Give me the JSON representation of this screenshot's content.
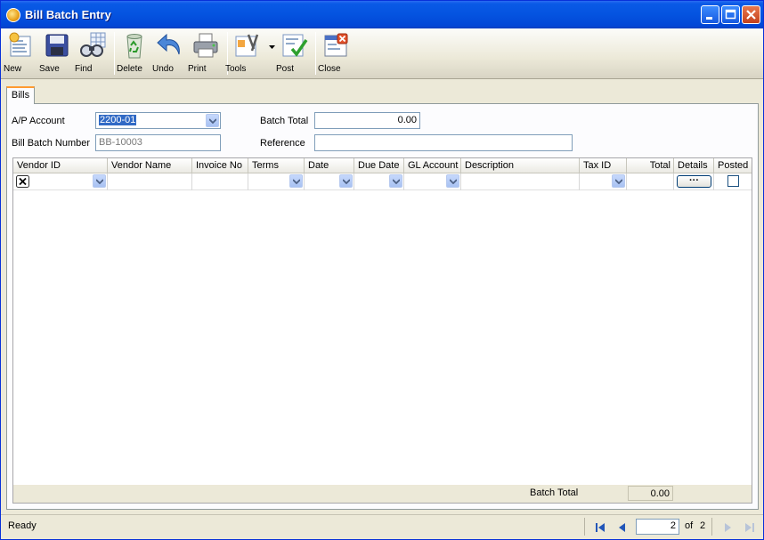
{
  "window": {
    "title": "Bill Batch Entry"
  },
  "toolbar": {
    "new": "New",
    "save": "Save",
    "find": "Find",
    "delete": "Delete",
    "undo": "Undo",
    "print": "Print",
    "tools": "Tools",
    "post": "Post",
    "close": "Close"
  },
  "tabs": [
    {
      "label": "Bills"
    }
  ],
  "form": {
    "ap_account_label": "A/P Account",
    "ap_account_value": "2200-01",
    "bill_batch_number_label": "Bill Batch Number",
    "bill_batch_number_value": "BB-10003",
    "batch_total_label": "Batch Total",
    "batch_total_value": "0.00",
    "reference_label": "Reference",
    "reference_value": ""
  },
  "grid": {
    "columns": [
      "Vendor ID",
      "Vendor Name",
      "Invoice No",
      "Terms",
      "Date",
      "Due Date",
      "GL Account",
      "Description",
      "Tax ID",
      "Total",
      "Details",
      "Posted"
    ],
    "details_button": "···",
    "footer_label": "Batch Total",
    "footer_value": "0.00"
  },
  "status": {
    "text": "Ready",
    "page": "2",
    "of_label": "of",
    "total_pages": "2"
  }
}
